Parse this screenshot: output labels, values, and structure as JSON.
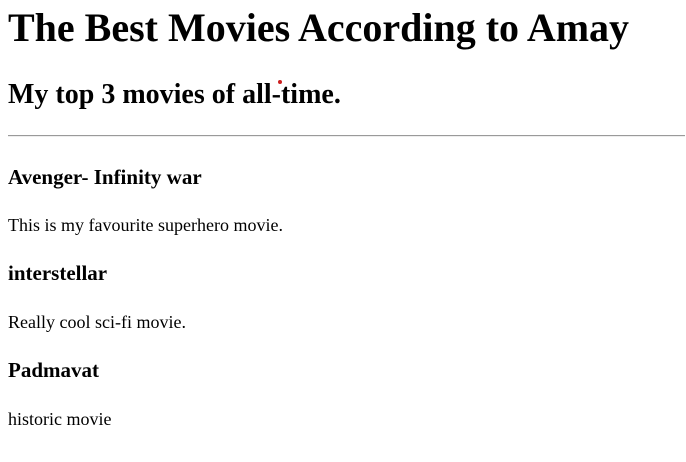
{
  "page": {
    "title": "The Best Movies According to Amay",
    "subtitle": "My top 3 movies of all-time."
  },
  "movies": [
    {
      "title": "Avenger- Infinity war",
      "description": "This is my favourite superhero movie."
    },
    {
      "title": "interstellar",
      "description": "Really cool sci-fi movie."
    },
    {
      "title": "Padmavat",
      "description": "historic movie"
    }
  ]
}
